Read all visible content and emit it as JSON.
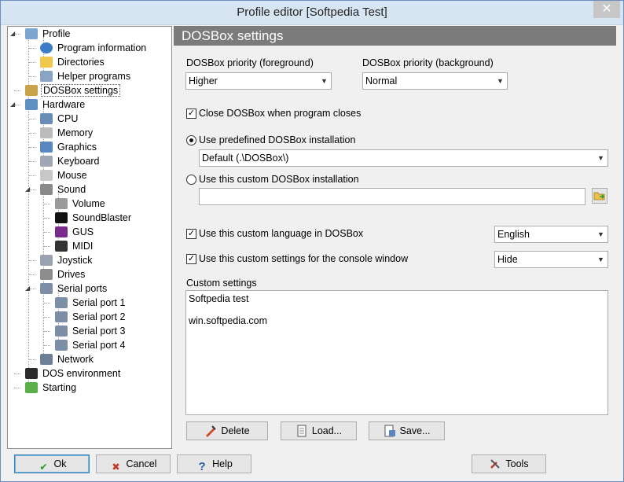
{
  "window": {
    "title": "Profile editor [Softpedia Test]",
    "close": "✕"
  },
  "tree": {
    "items": [
      {
        "label": "Profile",
        "icon": "profile-gear-icon",
        "color": "#7aa6cf"
      },
      {
        "label": "Program information",
        "icon": "info-icon",
        "color": "#3d7cc9"
      },
      {
        "label": "Directories",
        "icon": "folder-icon",
        "color": "#f2c84b"
      },
      {
        "label": "Helper programs",
        "icon": "helper-icon",
        "color": "#8aa4c4"
      },
      {
        "label": "DOSBox settings",
        "icon": "dosbox-icon",
        "color": "#c9a24a"
      },
      {
        "label": "Hardware",
        "icon": "hardware-icon",
        "color": "#5e8fc3"
      },
      {
        "label": "CPU",
        "icon": "cpu-icon",
        "color": "#6a8db5"
      },
      {
        "label": "Memory",
        "icon": "memory-icon",
        "color": "#bcbcbc"
      },
      {
        "label": "Graphics",
        "icon": "graphics-icon",
        "color": "#5b87c0"
      },
      {
        "label": "Keyboard",
        "icon": "keyboard-icon",
        "color": "#9ea7b3"
      },
      {
        "label": "Mouse",
        "icon": "mouse-icon",
        "color": "#c8c8c8"
      },
      {
        "label": "Sound",
        "icon": "sound-icon",
        "color": "#8a8a8a"
      },
      {
        "label": "Volume",
        "icon": "volume-icon",
        "color": "#9a9a9a"
      },
      {
        "label": "SoundBlaster",
        "icon": "soundblaster-icon",
        "color": "#111111"
      },
      {
        "label": "GUS",
        "icon": "gus-icon",
        "color": "#7a2a8a"
      },
      {
        "label": "MIDI",
        "icon": "midi-icon",
        "color": "#333333"
      },
      {
        "label": "Joystick",
        "icon": "joystick-icon",
        "color": "#9aa4b0"
      },
      {
        "label": "Drives",
        "icon": "drives-icon",
        "color": "#8d8d8d"
      },
      {
        "label": "Serial ports",
        "icon": "serial-ports-icon",
        "color": "#7d8ea6"
      },
      {
        "label": "Serial port 1",
        "icon": "serial-port-icon",
        "color": "#7d8ea6"
      },
      {
        "label": "Serial port 2",
        "icon": "serial-port-icon",
        "color": "#7d8ea6"
      },
      {
        "label": "Serial port 3",
        "icon": "serial-port-icon",
        "color": "#7d8ea6"
      },
      {
        "label": "Serial port 4",
        "icon": "serial-port-icon",
        "color": "#7d8ea6"
      },
      {
        "label": "Network",
        "icon": "network-icon",
        "color": "#6d7f96"
      },
      {
        "label": "DOS environment",
        "icon": "dos-console-icon",
        "color": "#2b2b2b"
      },
      {
        "label": "Starting",
        "icon": "starting-icon",
        "color": "#5bb04a"
      }
    ]
  },
  "panel": {
    "header": "DOSBox settings",
    "priority_fg": {
      "label": "DOSBox priority (foreground)",
      "value": "Higher"
    },
    "priority_bg": {
      "label": "DOSBox priority (background)",
      "value": "Normal"
    },
    "close_dosbox": {
      "label": "Close DOSBox when program closes",
      "checked": true
    },
    "use_predefined": {
      "label": "Use predefined DOSBox installation",
      "selected": true,
      "value": "Default (.\\DOSBox\\)"
    },
    "use_custom": {
      "label": "Use this custom DOSBox installation",
      "selected": false,
      "value": ""
    },
    "custom_language": {
      "label": "Use this custom language in DOSBox",
      "checked": true,
      "value": "English"
    },
    "console_settings": {
      "label": "Use this custom settings for the console window",
      "checked": true,
      "value": "Hide"
    },
    "custom_settings": {
      "label": "Custom settings",
      "lines": [
        "Softpedia test",
        "",
        "win.softpedia.com"
      ]
    },
    "buttons": {
      "delete": "Delete",
      "load": "Load...",
      "save": "Save..."
    }
  },
  "footer": {
    "ok": "Ok",
    "cancel": "Cancel",
    "help": "Help",
    "tools": "Tools"
  },
  "colors": {
    "header_bg": "#7b7b7b",
    "ok_icon": "#2e9b2e",
    "cancel_icon": "#c0392b",
    "help_icon": "#2a5db0"
  }
}
